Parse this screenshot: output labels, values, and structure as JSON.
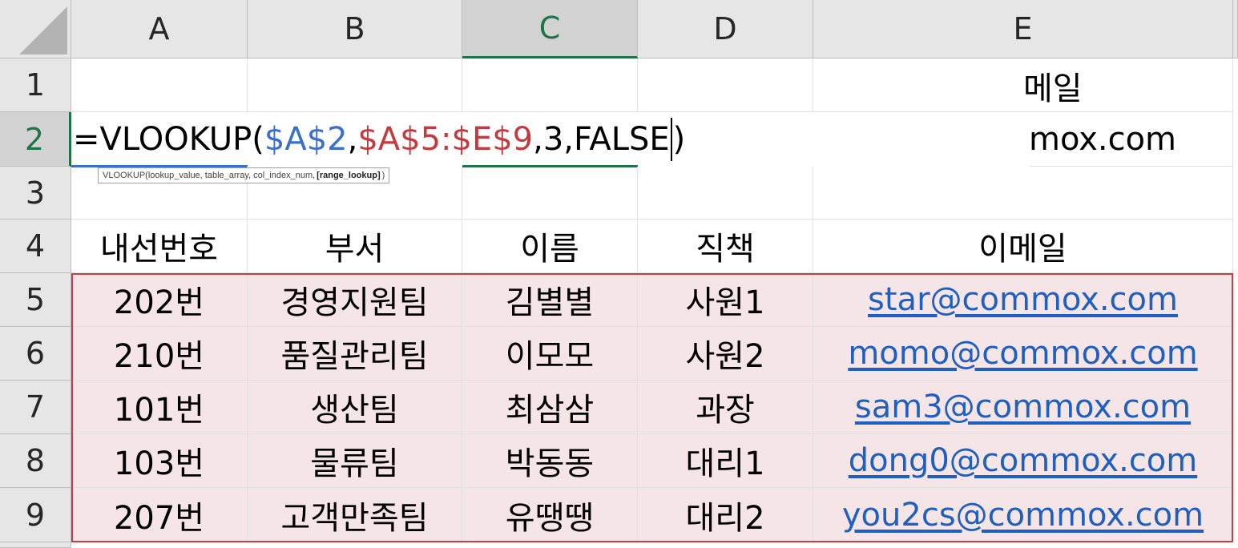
{
  "columns": [
    "A",
    "B",
    "C",
    "D",
    "E"
  ],
  "rows": [
    "1",
    "2",
    "3",
    "4",
    "5",
    "6",
    "7",
    "8",
    "9"
  ],
  "selected_column": "C",
  "selected_row": "2",
  "formula_editor": {
    "prefix": "=VLOOKUP(",
    "arg1": "$A$2",
    "comma1": ",",
    "arg2": "$A$5:$E$9",
    "rest_before_caret": ",3,FALSE",
    "rest_after_caret": ")"
  },
  "tooltip": {
    "before": "VLOOKUP(lookup_value, table_array, col_index_num, ",
    "bold": "[range_lookup]",
    "after": ")"
  },
  "partial_text": {
    "e1": "메일",
    "e2": "mox.com"
  },
  "headers": [
    "내선번호",
    "부서",
    "이름",
    "직책",
    "이메일"
  ],
  "table": [
    [
      "202번",
      "경영지원팀",
      "김별별",
      "사원1",
      "star@commox.com"
    ],
    [
      "210번",
      "품질관리팀",
      "이모모",
      "사원2",
      "momo@commox.com"
    ],
    [
      "101번",
      "생산팀",
      "최삼삼",
      "과장",
      "sam3@commox.com"
    ],
    [
      "103번",
      "물류팀",
      "박동동",
      "대리1",
      "dong0@commox.com"
    ],
    [
      "207번",
      "고객만족팀",
      "유땡땡",
      "대리2",
      "you2cs@commox.com"
    ]
  ],
  "colors": {
    "accent_green": "#217346",
    "range_blue": "#3b6fc8",
    "range_red": "#c23b40",
    "highlight_fill": "#f6e5e7",
    "link": "#1f5fbf"
  }
}
